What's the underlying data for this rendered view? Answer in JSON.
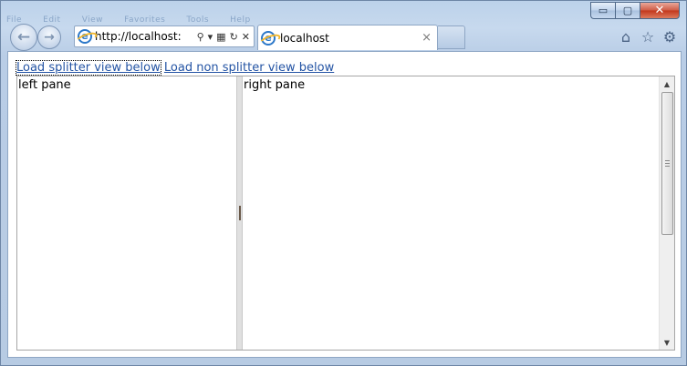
{
  "title_bar": {
    "ghost_menu": [
      "File",
      "Edit",
      "View",
      "Favorites",
      "Tools",
      "Help"
    ]
  },
  "window_controls": {
    "minimize": "▭",
    "maximize": "▢",
    "close": "✕"
  },
  "navigation": {
    "back_glyph": "←",
    "forward_glyph": "→"
  },
  "address_bar": {
    "url": "http://localhost:"
  },
  "tab": {
    "title": "localhost",
    "close_glyph": "×"
  },
  "toolbar": {
    "home_glyph": "⌂",
    "favorites_glyph": "☆",
    "settings_glyph": "⚙"
  },
  "page": {
    "links": [
      {
        "label": "Load splitter view below"
      },
      {
        "label": "Load non splitter view below"
      }
    ],
    "splitter": {
      "left_pane_text": "left pane",
      "right_pane_text": "right pane"
    }
  },
  "colors": {
    "link": "#2454a4",
    "frame": "#bcd2ea",
    "close_button": "#c2361c"
  }
}
